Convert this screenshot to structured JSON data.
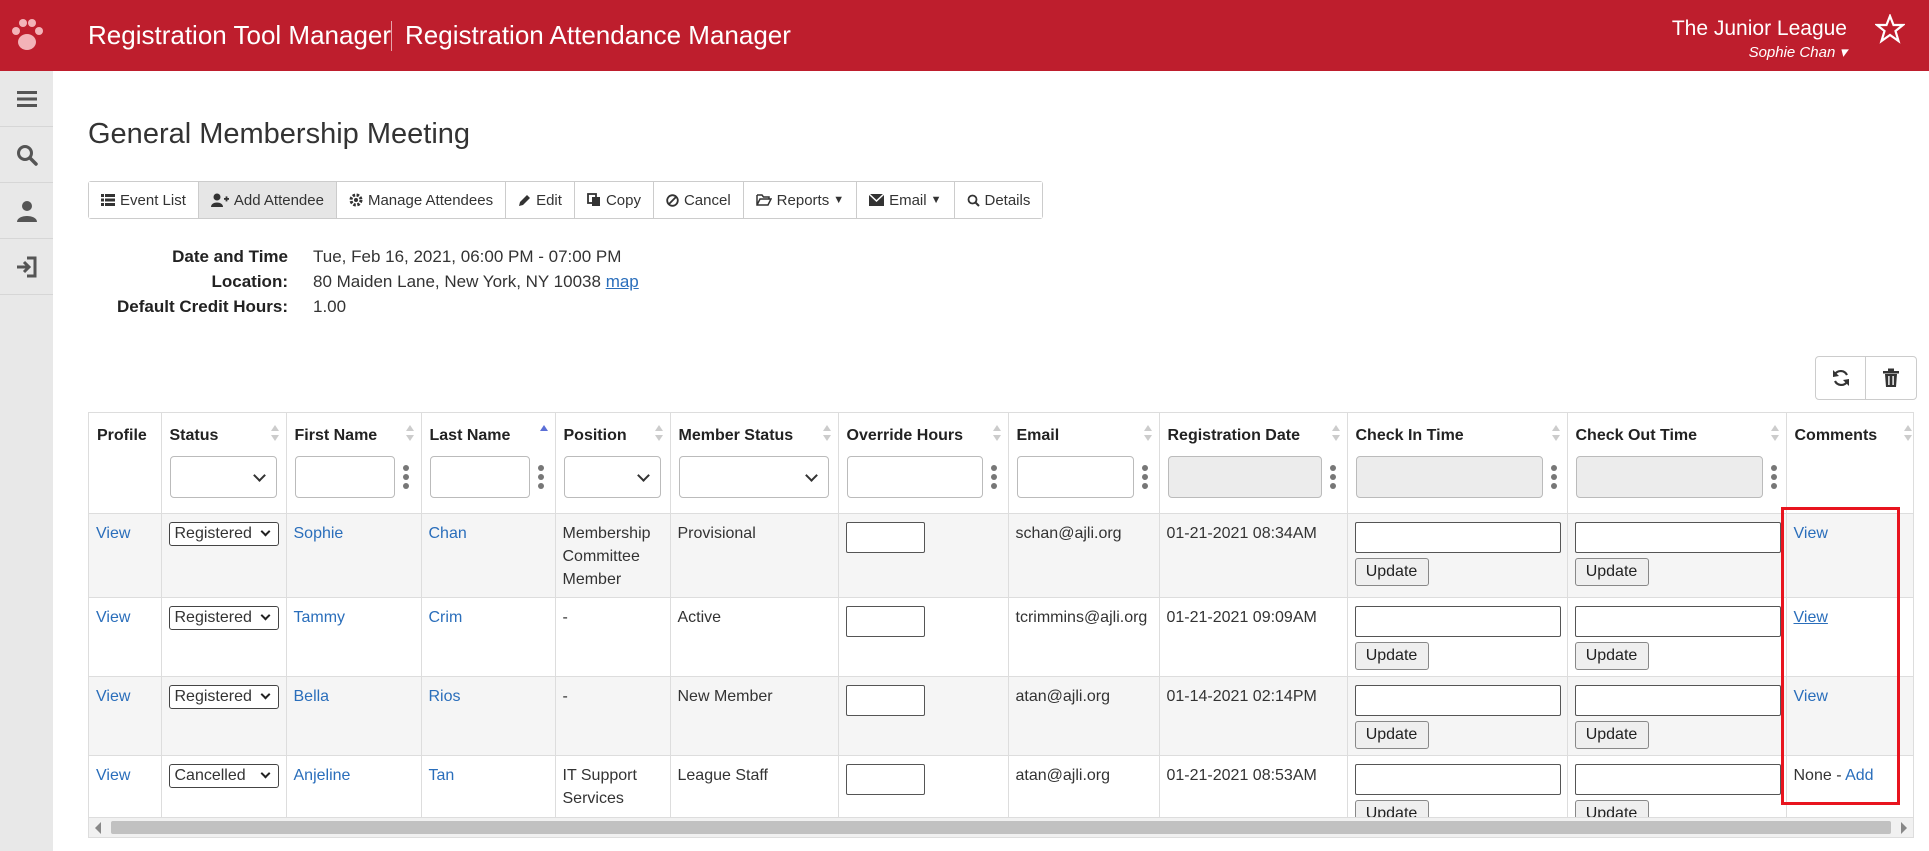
{
  "header": {
    "app_title": "Registration Tool Manager",
    "section_title": "Registration Attendance Manager",
    "org_name": "The Junior League",
    "user_name": "Sophie Chan",
    "brand_color": "#be1e2d"
  },
  "sidebar": {
    "items": [
      {
        "icon": "menu-icon"
      },
      {
        "icon": "search-icon"
      },
      {
        "icon": "user-icon"
      },
      {
        "icon": "sign-in-icon"
      }
    ]
  },
  "page": {
    "title": "General Membership Meeting"
  },
  "toolbar": {
    "event_list": "Event List",
    "add_attendee": "Add Attendee",
    "manage_attendees": "Manage Attendees",
    "edit": "Edit",
    "copy": "Copy",
    "cancel": "Cancel",
    "reports": "Reports",
    "email": "Email",
    "details": "Details"
  },
  "info": {
    "date_label": "Date and Time",
    "date_value": "Tue, Feb 16, 2021, 06:00 PM - 07:00 PM",
    "location_label": "Location:",
    "location_value": "80 Maiden Lane, New York, NY 10038",
    "map_link": "map",
    "credit_label": "Default Credit Hours:",
    "credit_value": "1.00"
  },
  "table": {
    "columns": [
      "Profile",
      "Status",
      "First Name",
      "Last Name",
      "Position",
      "Member Status",
      "Override Hours",
      "Email",
      "Registration Date",
      "Check In Time",
      "Check Out Time",
      "Comments"
    ],
    "update_label": "Update",
    "rows": [
      {
        "profile": "View",
        "status": "Registered",
        "first": "Sophie",
        "last": "Chan",
        "position": "Membership Committee Member",
        "member_status": "Provisional",
        "email": "schan@ajli.org",
        "reg_date": "01-21-2021 08:34AM",
        "comments": "View"
      },
      {
        "profile": "View",
        "status": "Registered",
        "first": "Tammy",
        "last": "Crim",
        "position": "-",
        "member_status": "Active",
        "email": "tcrimmins@ajli.org",
        "reg_date": "01-21-2021 09:09AM",
        "comments": "View"
      },
      {
        "profile": "View",
        "status": "Registered",
        "first": "Bella",
        "last": "Rios",
        "position": "-",
        "member_status": "New Member",
        "email": "atan@ajli.org",
        "reg_date": "01-14-2021 02:14PM",
        "comments": "View"
      },
      {
        "profile": "View",
        "status": "Cancelled",
        "first": "Anjeline",
        "last": "Tan",
        "position": "IT Support Services",
        "member_status": "League Staff",
        "email": "atan@ajli.org",
        "reg_date": "01-21-2021 08:53AM",
        "comments_none": "None",
        "comments_sep": " - ",
        "comments_add": "Add"
      }
    ]
  },
  "highlight_color": "#e8141e"
}
